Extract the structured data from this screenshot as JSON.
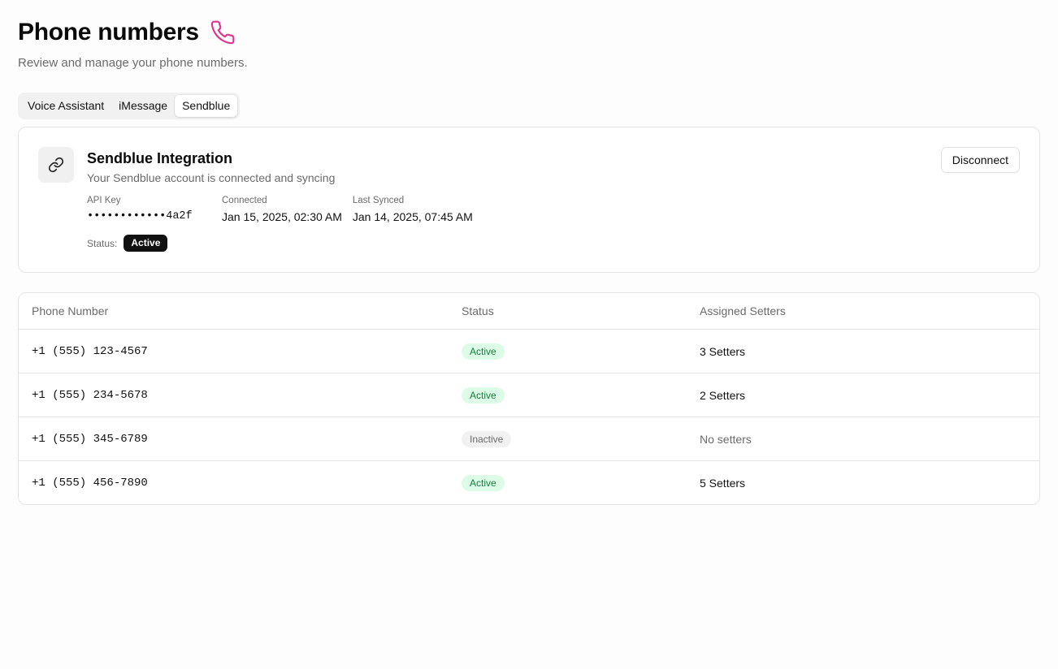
{
  "header": {
    "title": "Phone numbers",
    "title_icon": "phone-icon",
    "subtitle": "Review and manage your phone numbers.",
    "accent_color": "#e0338e"
  },
  "tabs": [
    {
      "label": "Voice Assistant",
      "active": false
    },
    {
      "label": "iMessage",
      "active": false
    },
    {
      "label": "Sendblue",
      "active": true
    }
  ],
  "integration": {
    "icon": "link-icon",
    "title": "Sendblue Integration",
    "description": "Your Sendblue account is connected and syncing",
    "api_key_label": "API Key",
    "api_key_value": "••••••••••••4a2f",
    "connected_label": "Connected",
    "connected_value": "Jan 15, 2025, 02:30 AM",
    "last_synced_label": "Last Synced",
    "last_synced_value": "Jan 14, 2025, 07:45 AM",
    "status_label": "Status:",
    "status_value": "Active",
    "disconnect_label": "Disconnect"
  },
  "table": {
    "headers": {
      "phone": "Phone Number",
      "status": "Status",
      "setters": "Assigned Setters"
    },
    "rows": [
      {
        "phone": "+1 (555) 123-4567",
        "status": "Active",
        "setters": "3 Setters"
      },
      {
        "phone": "+1 (555) 234-5678",
        "status": "Active",
        "setters": "2 Setters"
      },
      {
        "phone": "+1 (555) 345-6789",
        "status": "Inactive",
        "setters": "No setters"
      },
      {
        "phone": "+1 (555) 456-7890",
        "status": "Active",
        "setters": "5 Setters"
      }
    ]
  }
}
